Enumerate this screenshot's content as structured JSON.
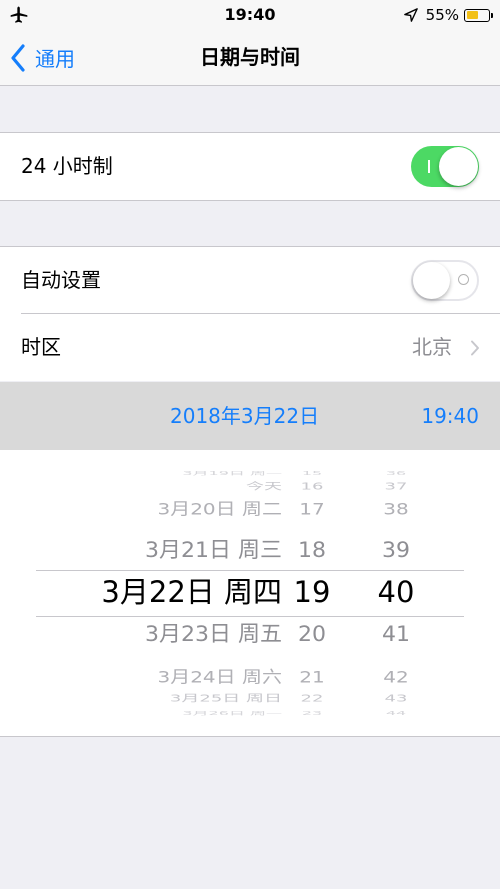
{
  "status_bar": {
    "time": "19:40",
    "battery_percent": "55%",
    "battery_level": 0.55,
    "battery_color": "#f2c018",
    "icons": [
      "airplane-icon",
      "location-arrow-icon",
      "battery-icon"
    ]
  },
  "nav": {
    "back_label": "通用",
    "title": "日期与时间",
    "accent_color": "#157efb"
  },
  "settings": {
    "hour24": {
      "label": "24 小时制",
      "enabled": true
    },
    "auto_set": {
      "label": "自动设置",
      "enabled": false
    },
    "timezone": {
      "label": "时区",
      "value": "北京"
    }
  },
  "datetime": {
    "date": "2018年3月22日",
    "time": "19:40"
  },
  "picker": {
    "dates": [
      {
        "day": "3月19日",
        "weekday": "周一"
      },
      {
        "day": "",
        "weekday": "今天"
      },
      {
        "day": "3月20日",
        "weekday": "周二"
      },
      {
        "day": "3月21日",
        "weekday": "周三"
      },
      {
        "day": "3月22日",
        "weekday": "周四"
      },
      {
        "day": "3月23日",
        "weekday": "周五"
      },
      {
        "day": "3月24日",
        "weekday": "周六"
      },
      {
        "day": "3月25日",
        "weekday": "周日"
      },
      {
        "day": "3月26日",
        "weekday": "周一"
      }
    ],
    "hours": [
      "15",
      "16",
      "17",
      "18",
      "19",
      "20",
      "21",
      "22",
      "23"
    ],
    "minutes": [
      "36",
      "37",
      "38",
      "39",
      "40",
      "41",
      "42",
      "43",
      "44"
    ],
    "selected_index": 4
  }
}
